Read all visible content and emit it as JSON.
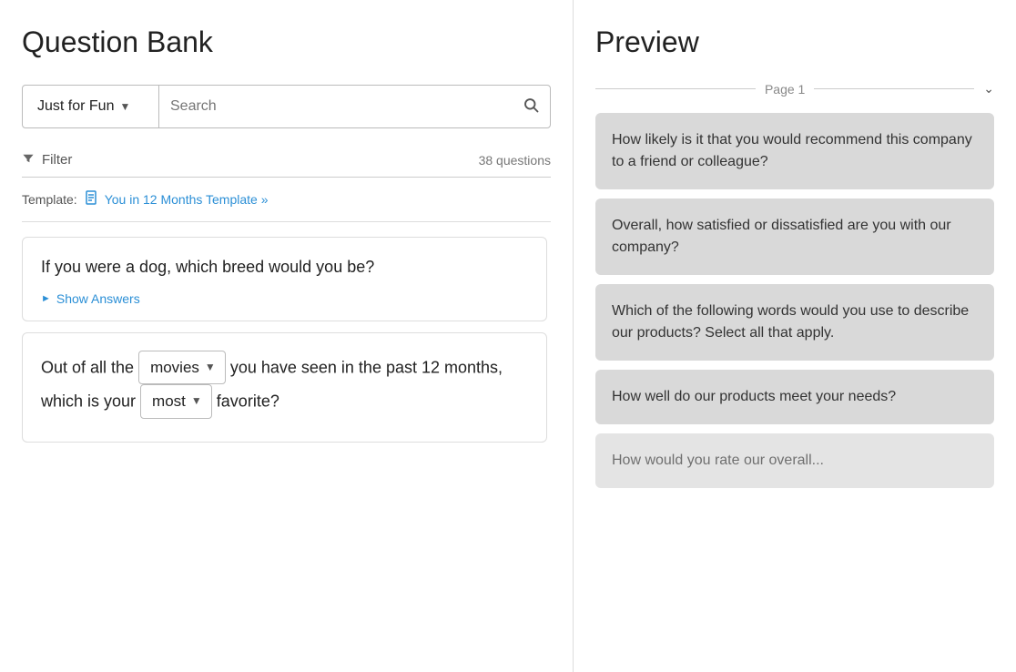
{
  "left": {
    "title": "Question Bank",
    "search_bar": {
      "category": "Just for Fun",
      "placeholder": "Search"
    },
    "filter": {
      "label": "Filter",
      "count": "38 questions"
    },
    "template": {
      "label": "Template:",
      "link_text": "You in 12 Months Template »"
    },
    "questions": [
      {
        "text": "If you were a dog, which breed would you be?",
        "show_answers_label": "Show Answers"
      },
      {
        "inline_parts": [
          {
            "type": "text",
            "value": "Out of all the "
          },
          {
            "type": "select",
            "value": "movies"
          },
          {
            "type": "text",
            "value": " you have seen in the past 12 months, which is your "
          },
          {
            "type": "select",
            "value": "most"
          },
          {
            "type": "text",
            "value": " favorite?"
          }
        ]
      }
    ]
  },
  "right": {
    "title": "Preview",
    "page_label": "Page 1",
    "questions": [
      "How likely is it that you would recommend this company to a friend or colleague?",
      "Overall, how satisfied or dissatisfied are you with our company?",
      "Which of the following words would you use to describe our products? Select all that apply.",
      "How well do our products meet your needs?",
      "How would you rate our overall..."
    ]
  }
}
